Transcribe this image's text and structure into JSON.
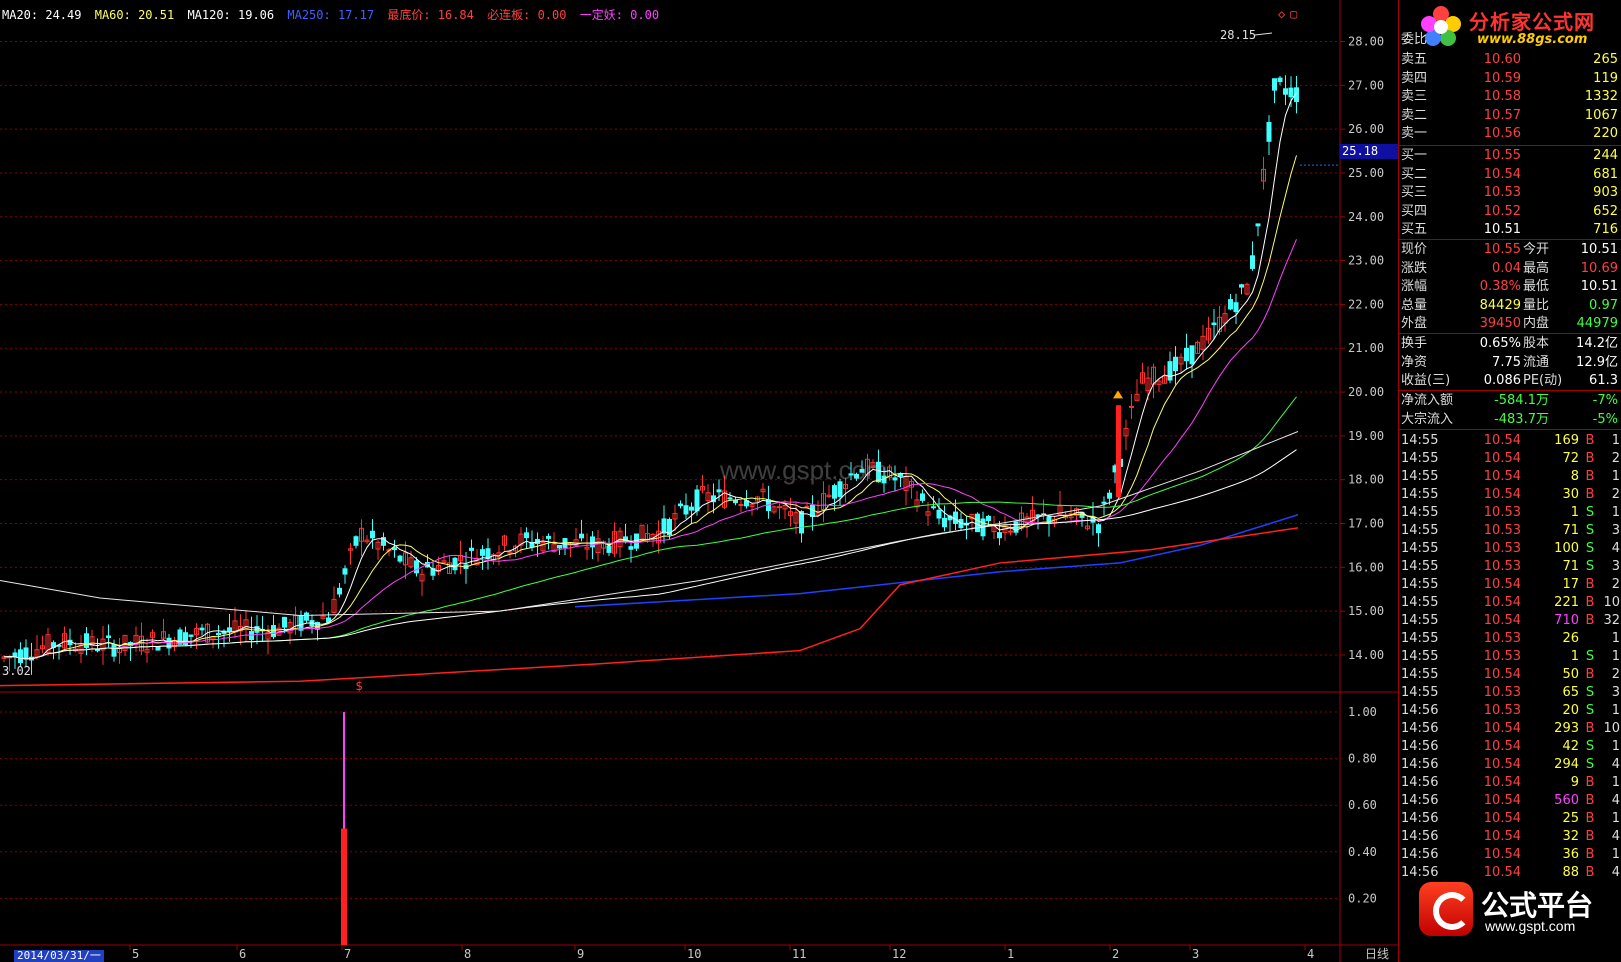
{
  "ma_legend": [
    {
      "label": "MA20: 24.49",
      "color": "#ffffff"
    },
    {
      "label": "MA60: 20.51",
      "color": "#ffff66"
    },
    {
      "label": "MA120: 19.06",
      "color": "#ffffff"
    },
    {
      "label": "MA250: 17.17",
      "color": "#4060ff"
    },
    {
      "label": "最底价: 16.84",
      "color": "#ff4040"
    },
    {
      "label": "必连板: 0.00",
      "color": "#ff4040"
    },
    {
      "label": "一定妖: 0.00",
      "color": "#ff40ff"
    }
  ],
  "price_axis": [
    "28.00",
    "27.00",
    "26.00",
    "25.00",
    "24.00",
    "23.00",
    "22.00",
    "21.00",
    "20.00",
    "19.00",
    "18.00",
    "17.00",
    "16.00",
    "15.00",
    "14.00"
  ],
  "price_range": [
    13.2,
    28.4
  ],
  "current_price_label": "25.18",
  "current_price_value": 25.18,
  "high_label": "28.15",
  "low_label": "3.02",
  "indicator_axis": [
    "1.00",
    "0.80",
    "0.60",
    "0.40",
    "0.20"
  ],
  "date_labels": [
    "2014/03/31/一",
    "5",
    "6",
    "7",
    "8",
    "9",
    "10",
    "11",
    "12",
    "1",
    "2",
    "3",
    "4"
  ],
  "period_label": "日线",
  "watermark": "www.gspt.com",
  "logo": {
    "title": "分析家公式网",
    "url": "www.88gs.com"
  },
  "gs_logo": {
    "title": "公式平台",
    "url": "www.gspt.com"
  },
  "order_book": {
    "header": "委比",
    "sell": [
      {
        "label": "卖五",
        "price": "10.60",
        "vol": "265"
      },
      {
        "label": "卖四",
        "price": "10.59",
        "vol": "119"
      },
      {
        "label": "卖三",
        "price": "10.58",
        "vol": "1332"
      },
      {
        "label": "卖二",
        "price": "10.57",
        "vol": "1067"
      },
      {
        "label": "卖一",
        "price": "10.56",
        "vol": "220"
      }
    ],
    "buy": [
      {
        "label": "买一",
        "price": "10.55",
        "vol": "244"
      },
      {
        "label": "买二",
        "price": "10.54",
        "vol": "681"
      },
      {
        "label": "买三",
        "price": "10.53",
        "vol": "903"
      },
      {
        "label": "买四",
        "price": "10.52",
        "vol": "652"
      },
      {
        "label": "买五",
        "price": "10.51",
        "vol": "716"
      }
    ]
  },
  "quote": [
    {
      "l1": "现价",
      "v1": "10.55",
      "c1": "red",
      "l2": "今开",
      "v2": "10.51",
      "c2": "white"
    },
    {
      "l1": "涨跌",
      "v1": "0.04",
      "c1": "red",
      "l2": "最高",
      "v2": "10.69",
      "c2": "red"
    },
    {
      "l1": "涨幅",
      "v1": "0.38%",
      "c1": "red",
      "l2": "最低",
      "v2": "10.51",
      "c2": "white"
    },
    {
      "l1": "总量",
      "v1": "84429",
      "c1": "yellow",
      "l2": "量比",
      "v2": "0.97",
      "c2": "green"
    },
    {
      "l1": "外盘",
      "v1": "39450",
      "c1": "red",
      "l2": "内盘",
      "v2": "44979",
      "c2": "green"
    }
  ],
  "finance": [
    {
      "l1": "换手",
      "v1": "0.65%",
      "l2": "股本",
      "v2": "14.2亿"
    },
    {
      "l1": "净资",
      "v1": "7.75",
      "l2": "流通",
      "v2": "12.9亿"
    },
    {
      "l1": "收益(三)",
      "v1": "0.086",
      "l2": "PE(动)",
      "v2": "61.3"
    }
  ],
  "flow": [
    {
      "label": "净流入额",
      "v1": "-584.1万",
      "v2": "-7%"
    },
    {
      "label": "大宗流入",
      "v1": "-483.7万",
      "v2": "-5%"
    }
  ],
  "ticks": [
    {
      "t": "14:55",
      "p": "10.54",
      "pc": "red",
      "v": "169",
      "vc": "yellow",
      "bs": "B",
      "n": "1"
    },
    {
      "t": "14:55",
      "p": "10.54",
      "pc": "red",
      "v": "72",
      "vc": "yellow",
      "bs": "B",
      "n": "2"
    },
    {
      "t": "14:55",
      "p": "10.54",
      "pc": "red",
      "v": "8",
      "vc": "yellow",
      "bs": "B",
      "n": "1"
    },
    {
      "t": "14:55",
      "p": "10.54",
      "pc": "red",
      "v": "30",
      "vc": "yellow",
      "bs": "B",
      "n": "2"
    },
    {
      "t": "14:55",
      "p": "10.53",
      "pc": "red",
      "v": "1",
      "vc": "yellow",
      "bs": "S",
      "n": "1"
    },
    {
      "t": "14:55",
      "p": "10.53",
      "pc": "red",
      "v": "71",
      "vc": "yellow",
      "bs": "S",
      "n": "3"
    },
    {
      "t": "14:55",
      "p": "10.53",
      "pc": "red",
      "v": "100",
      "vc": "yellow",
      "bs": "S",
      "n": "4"
    },
    {
      "t": "14:55",
      "p": "10.53",
      "pc": "red",
      "v": "71",
      "vc": "yellow",
      "bs": "S",
      "n": "3"
    },
    {
      "t": "14:55",
      "p": "10.54",
      "pc": "red",
      "v": "17",
      "vc": "yellow",
      "bs": "B",
      "n": "2"
    },
    {
      "t": "14:55",
      "p": "10.54",
      "pc": "red",
      "v": "221",
      "vc": "yellow",
      "bs": "B",
      "n": "10"
    },
    {
      "t": "14:55",
      "p": "10.54",
      "pc": "red",
      "v": "710",
      "vc": "magenta",
      "bs": "B",
      "n": "32"
    },
    {
      "t": "14:55",
      "p": "10.53",
      "pc": "red",
      "v": "26",
      "vc": "yellow",
      "bs": "",
      "n": "1"
    },
    {
      "t": "14:55",
      "p": "10.53",
      "pc": "red",
      "v": "1",
      "vc": "yellow",
      "bs": "S",
      "n": "1"
    },
    {
      "t": "14:55",
      "p": "10.54",
      "pc": "red",
      "v": "50",
      "vc": "yellow",
      "bs": "B",
      "n": "2"
    },
    {
      "t": "14:55",
      "p": "10.53",
      "pc": "red",
      "v": "65",
      "vc": "yellow",
      "bs": "S",
      "n": "3"
    },
    {
      "t": "14:56",
      "p": "10.53",
      "pc": "red",
      "v": "20",
      "vc": "yellow",
      "bs": "S",
      "n": "1"
    },
    {
      "t": "14:56",
      "p": "10.54",
      "pc": "red",
      "v": "293",
      "vc": "yellow",
      "bs": "B",
      "n": "10"
    },
    {
      "t": "14:56",
      "p": "10.54",
      "pc": "red",
      "v": "42",
      "vc": "yellow",
      "bs": "S",
      "n": "1"
    },
    {
      "t": "14:56",
      "p": "10.54",
      "pc": "red",
      "v": "294",
      "vc": "yellow",
      "bs": "S",
      "n": "4"
    },
    {
      "t": "14:56",
      "p": "10.54",
      "pc": "red",
      "v": "9",
      "vc": "yellow",
      "bs": "B",
      "n": "1"
    },
    {
      "t": "14:56",
      "p": "10.54",
      "pc": "red",
      "v": "560",
      "vc": "magenta",
      "bs": "B",
      "n": "4"
    },
    {
      "t": "14:56",
      "p": "10.54",
      "pc": "red",
      "v": "25",
      "vc": "yellow",
      "bs": "B",
      "n": "1"
    },
    {
      "t": "14:56",
      "p": "10.54",
      "pc": "red",
      "v": "32",
      "vc": "yellow",
      "bs": "B",
      "n": "4"
    },
    {
      "t": "14:56",
      "p": "10.54",
      "pc": "red",
      "v": "36",
      "vc": "yellow",
      "bs": "B",
      "n": "1"
    },
    {
      "t": "14:56",
      "p": "10.54",
      "pc": "red",
      "v": "88",
      "vc": "yellow",
      "bs": "B",
      "n": "4"
    }
  ],
  "colors": {
    "grid": "#8b0000",
    "up": "#ff3030",
    "down": "#40ffff",
    "ma5": "#ffffff",
    "ma10": "#ffff66",
    "ma20": "#ff40ff",
    "ma60": "#40ff40",
    "ma120": "#ffffff",
    "ma250": "#2040ff",
    "floor": "#ff2020"
  }
}
